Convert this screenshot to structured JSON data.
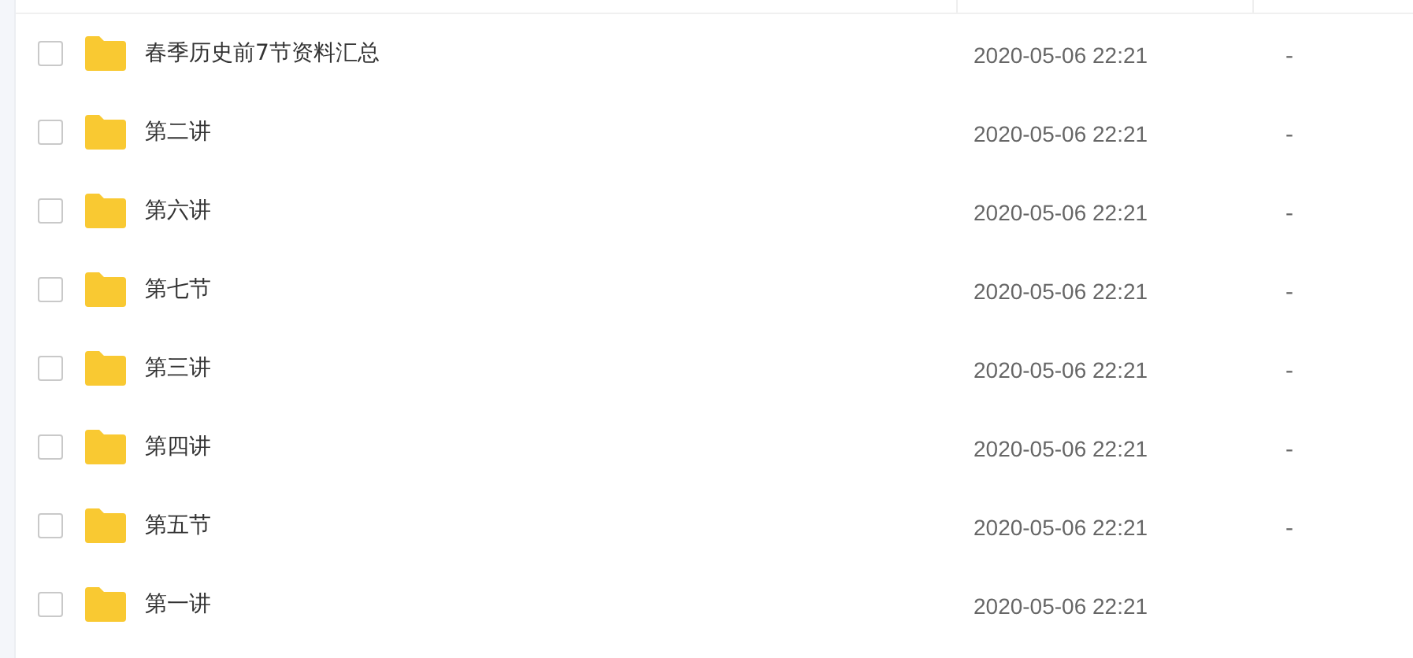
{
  "rows": [
    {
      "name": "春季历史前7节资料汇总",
      "modified": "2020-05-06 22:21",
      "size": "-",
      "checked": false
    },
    {
      "name": "第二讲",
      "modified": "2020-05-06 22:21",
      "size": "-",
      "checked": false
    },
    {
      "name": "第六讲",
      "modified": "2020-05-06 22:21",
      "size": "-",
      "checked": false
    },
    {
      "name": "第七节",
      "modified": "2020-05-06 22:21",
      "size": "-",
      "checked": false
    },
    {
      "name": "第三讲",
      "modified": "2020-05-06 22:21",
      "size": "-",
      "checked": false
    },
    {
      "name": "第四讲",
      "modified": "2020-05-06 22:21",
      "size": "-",
      "checked": false
    },
    {
      "name": "第五节",
      "modified": "2020-05-06 22:21",
      "size": "-",
      "checked": false
    },
    {
      "name": "第一讲",
      "modified": "2020-05-06 22:21",
      "checked": false
    }
  ]
}
